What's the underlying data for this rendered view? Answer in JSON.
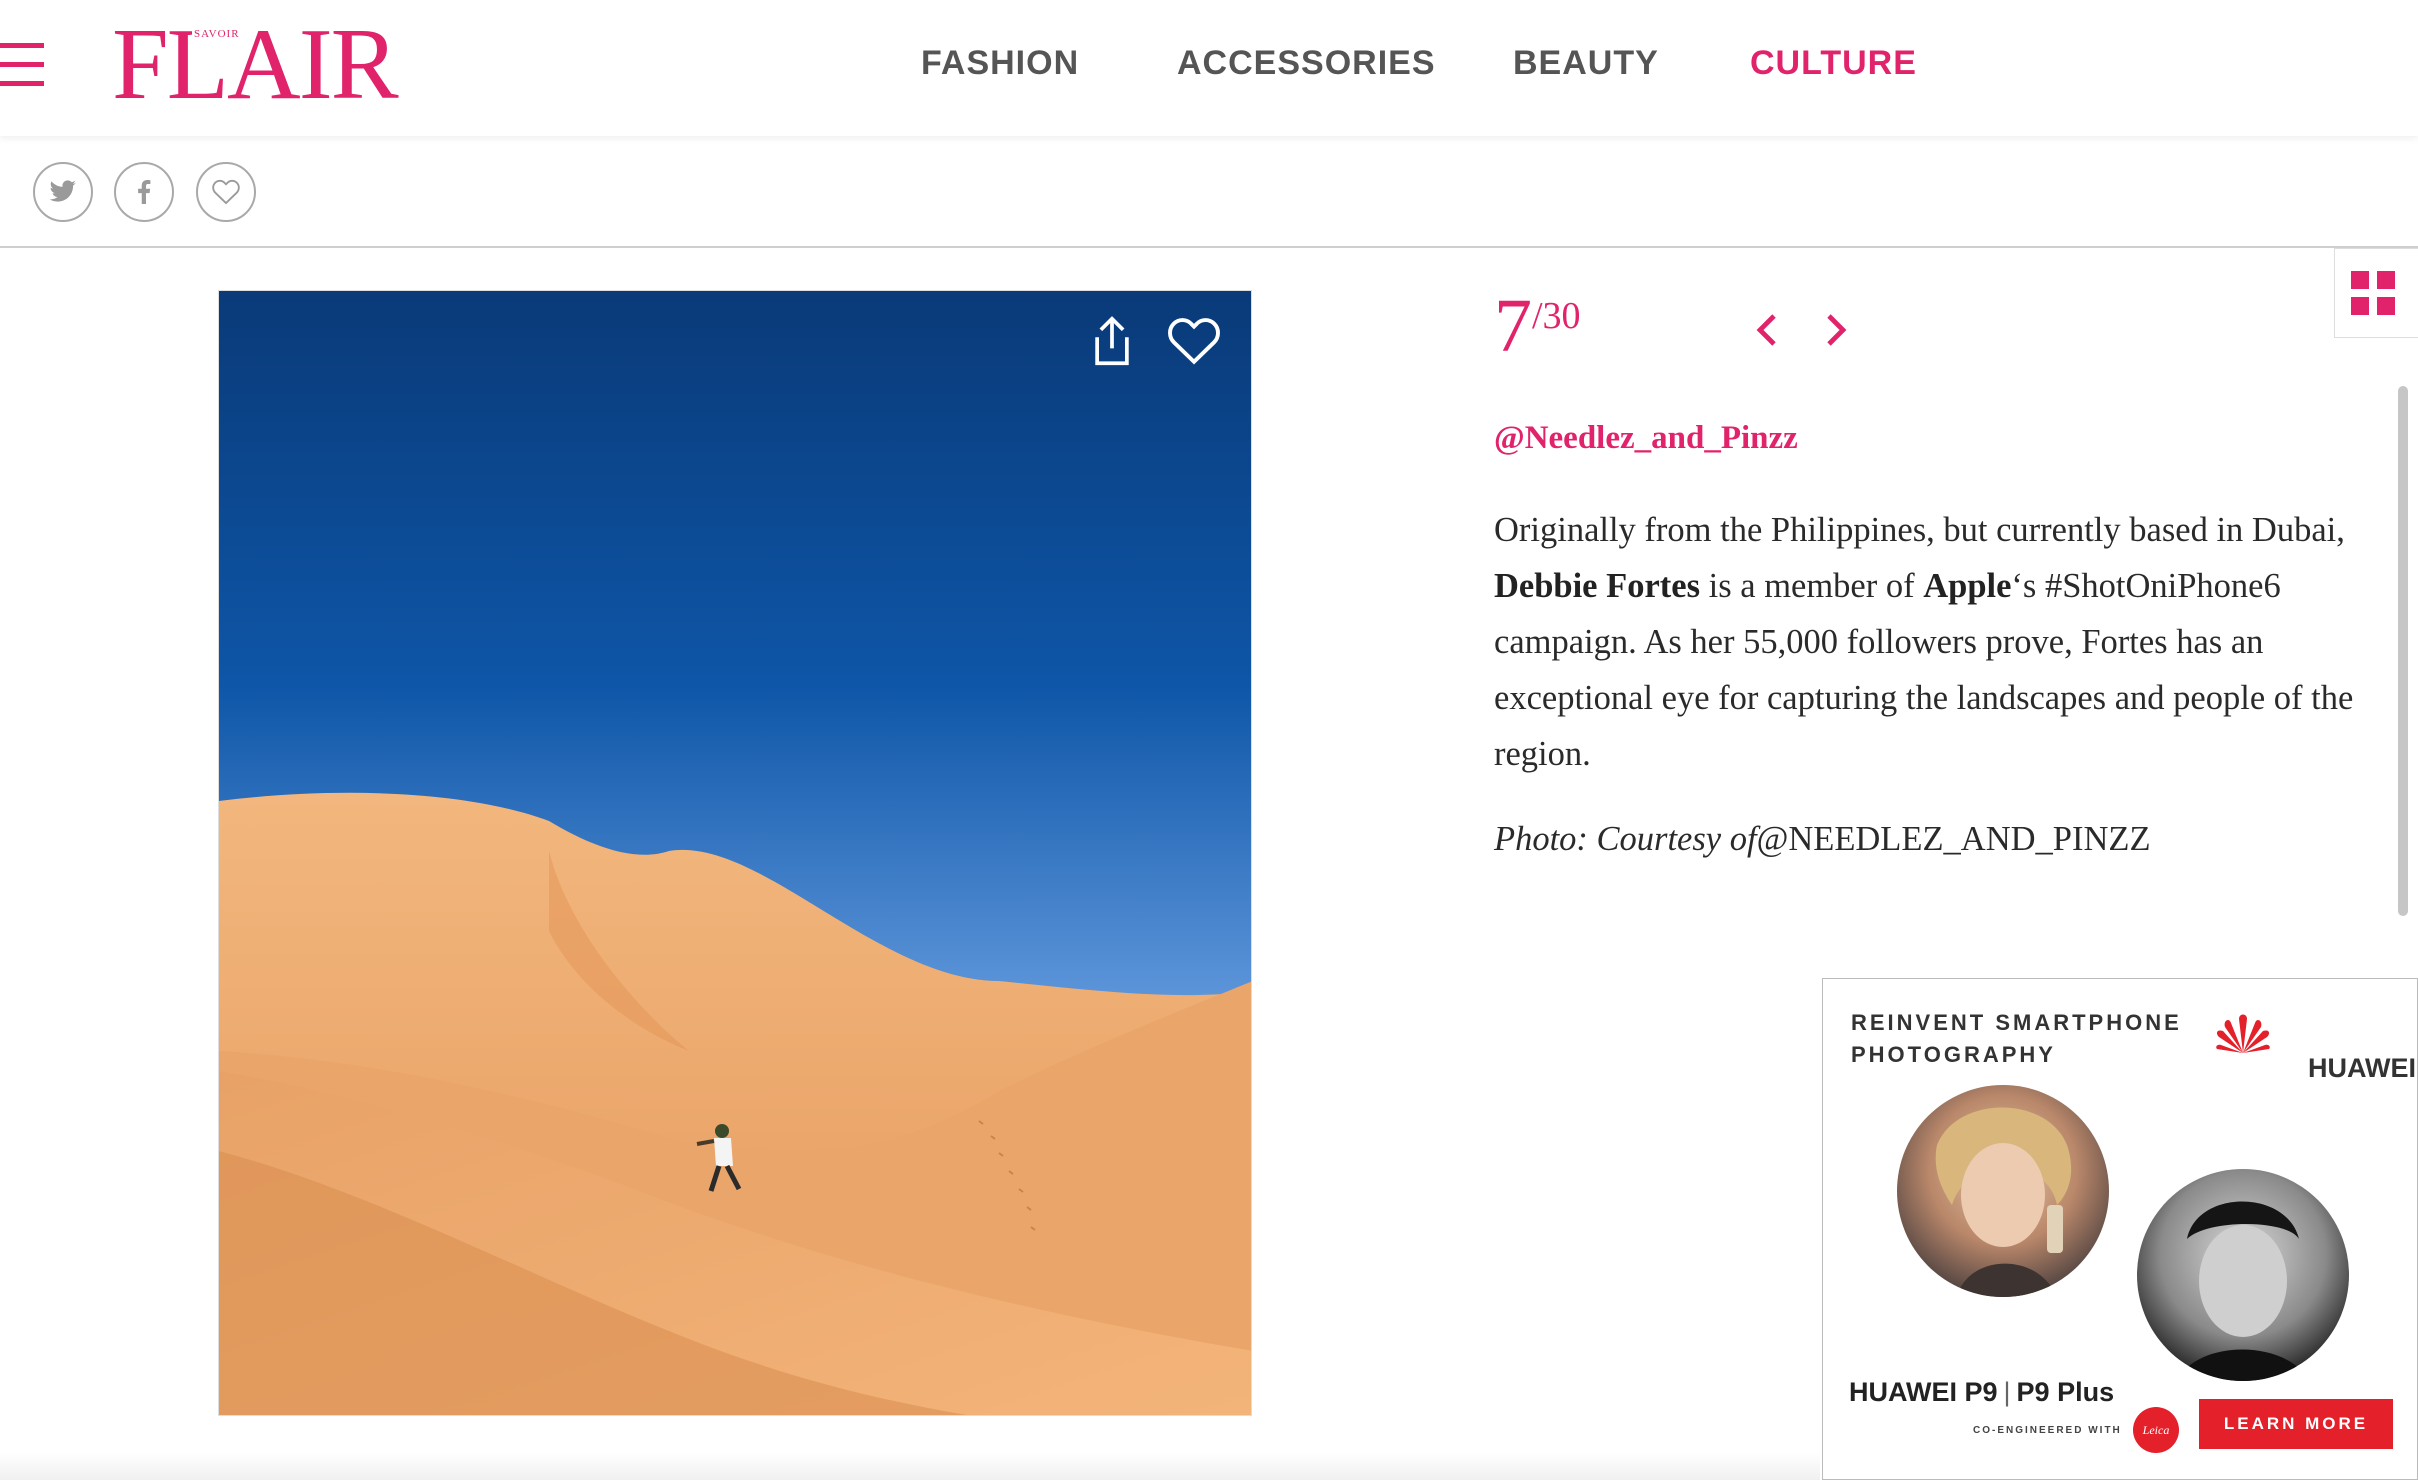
{
  "header": {
    "logo_main": "FLAIR",
    "logo_small": "SAVOIR",
    "nav": [
      {
        "label": "FASHION",
        "active": false
      },
      {
        "label": "ACCESSORIES",
        "active": false
      },
      {
        "label": "BEAUTY",
        "active": false
      },
      {
        "label": "CULTURE",
        "active": true
      }
    ]
  },
  "share": {
    "icons": [
      "twitter-icon",
      "facebook-icon",
      "heart-icon"
    ]
  },
  "gallery": {
    "current": "7",
    "total": "/30",
    "handle": "@Needlez_and_Pinzz",
    "desc_1": "Originally from the Philippines, but currently based in Dubai, ",
    "desc_bold_1": "Debbie Fortes",
    "desc_2": " is a member of ",
    "desc_bold_2": "Apple",
    "desc_3": "‘s #ShotOniPhone6 campaign. As her 55,000 followers prove, Fortes has an exceptional eye for capturing the landscapes and people of the region.",
    "credit_label": "Photo: Courtesy of",
    "credit_handle": "@NEEDLEZ_AND_PINZZ",
    "photo_icons": [
      "share-icon",
      "heart-icon"
    ]
  },
  "ad": {
    "title": "REINVENT SMARTPHONE PHOTOGRAPHY",
    "brand": "HUAWEI",
    "model_1": "HUAWEI P9",
    "separator": "|",
    "model_2": "P9 Plus",
    "co_engineered": "CO-ENGINEERED WITH",
    "leica": "Leica",
    "cta": "LEARN MORE"
  },
  "colors": {
    "accent": "#e0236b",
    "ad_red": "#e4202b"
  }
}
